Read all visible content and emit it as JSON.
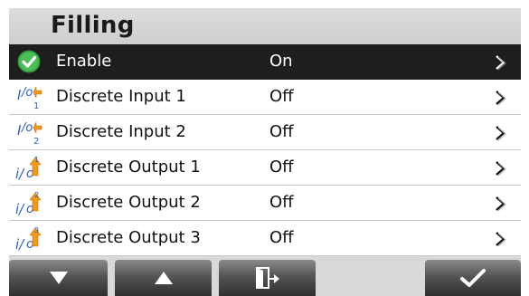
{
  "header": {
    "title": "Filling"
  },
  "rows": [
    {
      "icon": "checkmark-circle-icon",
      "label": "Enable",
      "value": "On",
      "selected": true
    },
    {
      "icon": "discrete-input-1-icon",
      "label": "Discrete Input 1",
      "value": "Off"
    },
    {
      "icon": "discrete-input-2-icon",
      "label": "Discrete Input 2",
      "value": "Off"
    },
    {
      "icon": "discrete-output-1-icon",
      "label": "Discrete Output 1",
      "value": "Off"
    },
    {
      "icon": "discrete-output-2-icon",
      "label": "Discrete Output 2",
      "value": "Off"
    },
    {
      "icon": "discrete-output-3-icon",
      "label": "Discrete Output 3",
      "value": "Off"
    }
  ],
  "toolbar": {
    "buttons": [
      {
        "icon": "arrow-down-icon"
      },
      {
        "icon": "arrow-up-icon"
      },
      {
        "icon": "exit-icon"
      },
      {
        "icon": "checkmark-icon"
      }
    ]
  },
  "colors": {
    "selected_row": "#1e1e1e",
    "enable_icon_green": "#3fae49",
    "io_icon_blue": "#2f62c8",
    "io_icon_orange": "#f09a1c"
  }
}
